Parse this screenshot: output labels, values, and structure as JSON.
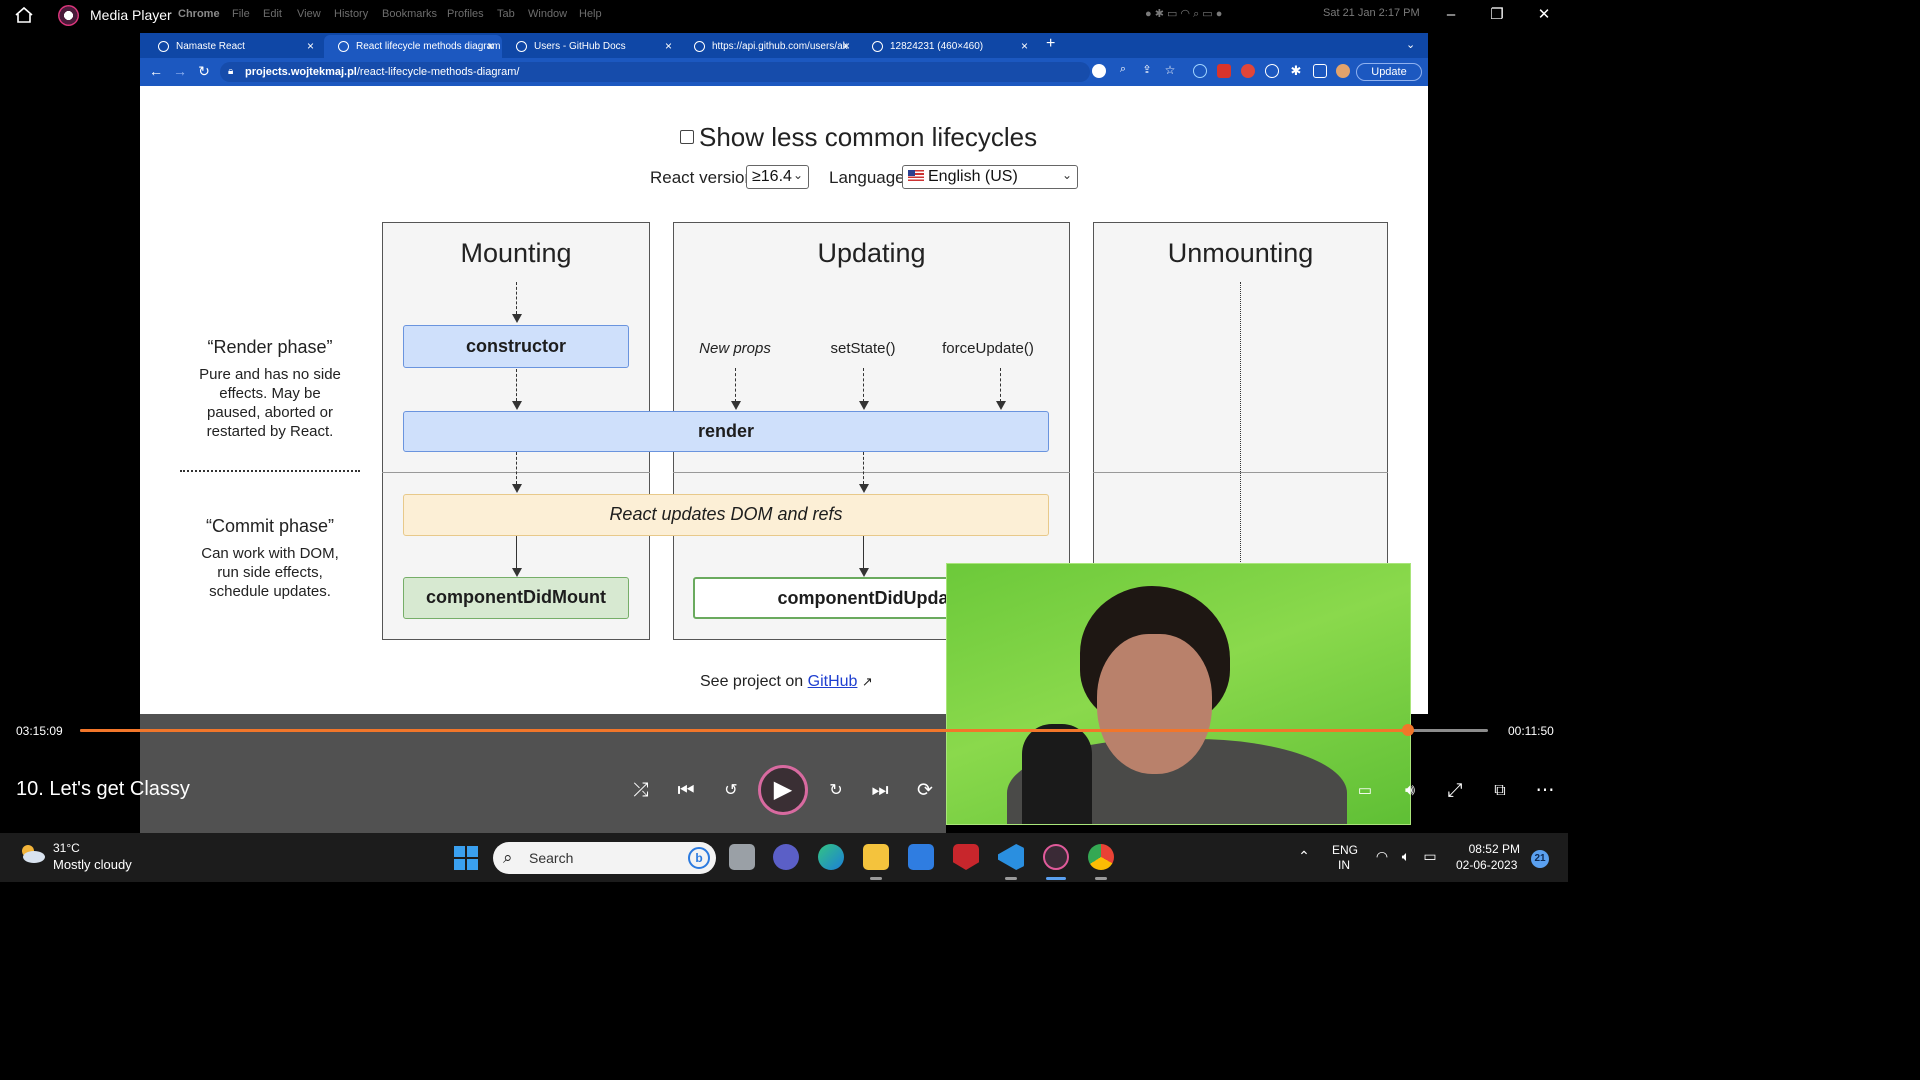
{
  "media_player": {
    "app_title": "Media Player",
    "mac_menu": [
      "Chrome",
      "File",
      "Edit",
      "View",
      "History",
      "Bookmarks",
      "Profiles",
      "Tab",
      "Window",
      "Help"
    ],
    "mac_clock": "Sat 21 Jan  2:17 PM"
  },
  "browser": {
    "tabs": [
      {
        "label": "Namaste React",
        "active": false
      },
      {
        "label": "React lifecycle methods diagram",
        "active": true
      },
      {
        "label": "Users - GitHub Docs",
        "active": false
      },
      {
        "label": "https://api.github.com/users/ak",
        "active": false
      },
      {
        "label": "12824231 (460×460)",
        "active": false
      }
    ],
    "new_tab": "+",
    "url_host": "projects.wojtekmaj.pl",
    "url_path": "/react-lifecycle-methods-diagram/",
    "update_label": "Update"
  },
  "diagram_page": {
    "show_less_label": "Show less common lifecycles",
    "react_version_label": "React version",
    "react_version_value": "≥16.4",
    "language_label": "Language",
    "language_value": "English (US)",
    "columns": [
      "Mounting",
      "Updating",
      "Unmounting"
    ],
    "render_phase": {
      "title": "“Render phase”",
      "desc": [
        "Pure and has no side",
        "effects. May be",
        "paused, aborted or",
        "restarted by React."
      ]
    },
    "commit_phase": {
      "title": "“Commit phase”",
      "desc": [
        "Can work with DOM,",
        "run side effects,",
        "schedule updates."
      ]
    },
    "nodes": {
      "constructor": "constructor",
      "render": "render",
      "dom_update": "React updates DOM and refs",
      "did_mount": "componentDidMount",
      "did_update": "componentDidUpdate"
    },
    "triggers": [
      "New props",
      "setState()",
      "forceUpdate()"
    ],
    "see_project_prefix": "See project on ",
    "see_project_link": "GitHub"
  },
  "player": {
    "elapsed": "03:15:09",
    "remaining": "00:11:50",
    "progress_fraction": 0.9434,
    "video_title": "10. Let's get Classy",
    "accent_color": "#f2762a"
  },
  "taskbar": {
    "weather_temp": "31°C",
    "weather_desc": "Mostly cloudy",
    "search_placeholder": "Search",
    "lang_line1": "ENG",
    "lang_line2": "IN",
    "time": "08:52 PM",
    "date": "02-06-2023",
    "notification_count": "21"
  }
}
